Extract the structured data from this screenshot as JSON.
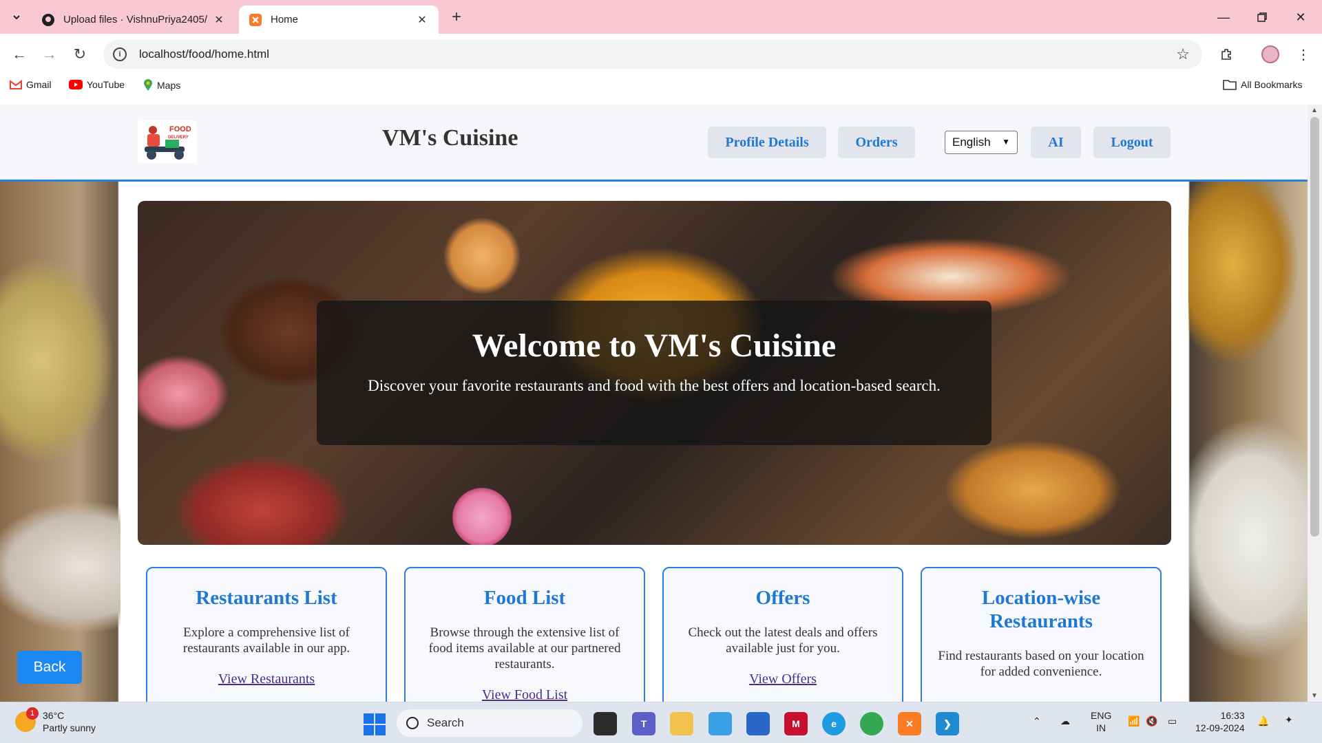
{
  "browser": {
    "tabs": [
      {
        "title": "Upload files · VishnuPriya2405/",
        "active": false
      },
      {
        "title": "Home",
        "active": true
      }
    ],
    "url": "localhost/food/home.html",
    "bookmarks": [
      "Gmail",
      "YouTube",
      "Maps"
    ],
    "all_bookmarks_label": "All Bookmarks"
  },
  "site": {
    "logo_text": "FOOD DELIVERY",
    "title": "VM's Cuisine",
    "nav": {
      "profile": "Profile Details",
      "orders": "Orders",
      "language": "English",
      "ai": "AI",
      "logout": "Logout"
    },
    "hero": {
      "title": "Welcome to VM's Cuisine",
      "subtitle": "Discover your favorite restaurants and food with the best offers and location-based search."
    },
    "cards": [
      {
        "title": "Restaurants List",
        "desc": "Explore a comprehensive list of restaurants available in our app.",
        "link": "View Restaurants"
      },
      {
        "title": "Food List",
        "desc": "Browse through the extensive list of food items available at our partnered restaurants.",
        "link": "View Food List"
      },
      {
        "title": "Offers",
        "desc": "Check out the latest deals and offers available just for you.",
        "link": "View Offers"
      },
      {
        "title": "Location-wise Restaurants",
        "desc": "Find restaurants based on your location for added convenience.",
        "link": ""
      }
    ],
    "back_label": "Back"
  },
  "taskbar": {
    "weather_temp": "36°C",
    "weather_desc": "Partly sunny",
    "weather_badge": "1",
    "search_placeholder": "Search",
    "lang_line1": "ENG",
    "lang_line2": "IN",
    "time": "16:33",
    "date": "12-09-2024"
  },
  "colors": {
    "accent": "#2a7de1",
    "tab_bar": "#f8c8d4",
    "back_button": "#1e88f2"
  }
}
